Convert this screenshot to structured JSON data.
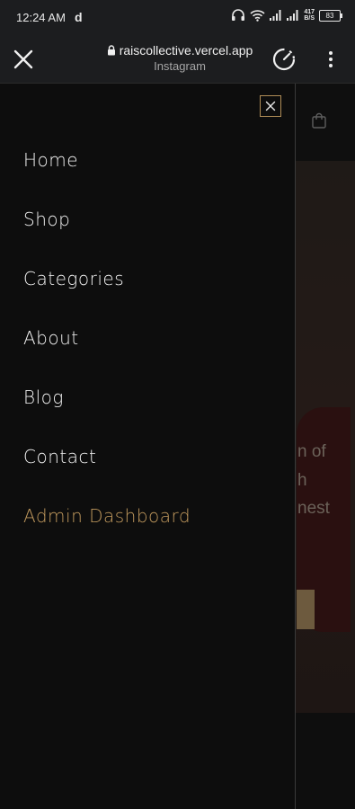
{
  "status_bar": {
    "time": "12:24 AM",
    "app_glyph": "d",
    "net_speed_value": "417",
    "net_speed_unit": "B/S",
    "battery": "83",
    "icons": [
      "headphones-icon",
      "wifi-icon",
      "signal-icon",
      "signal-icon"
    ]
  },
  "browser": {
    "domain": "raiscollective.vercel.app",
    "subtitle": "Instagram",
    "icons": [
      "close-icon",
      "lock-icon",
      "speedometer-icon",
      "more-vertical-icon"
    ]
  },
  "background_page": {
    "hero_text_lines": [
      "n of",
      "h",
      "nest"
    ]
  },
  "drawer": {
    "close_icon": "close-icon",
    "accent_color": "#c29a5e",
    "nav_items": [
      {
        "label": "Home"
      },
      {
        "label": "Shop"
      },
      {
        "label": "Categories"
      },
      {
        "label": "About"
      },
      {
        "label": "Blog"
      },
      {
        "label": "Contact"
      },
      {
        "label": "Admin Dashboard",
        "highlight": true
      }
    ]
  }
}
